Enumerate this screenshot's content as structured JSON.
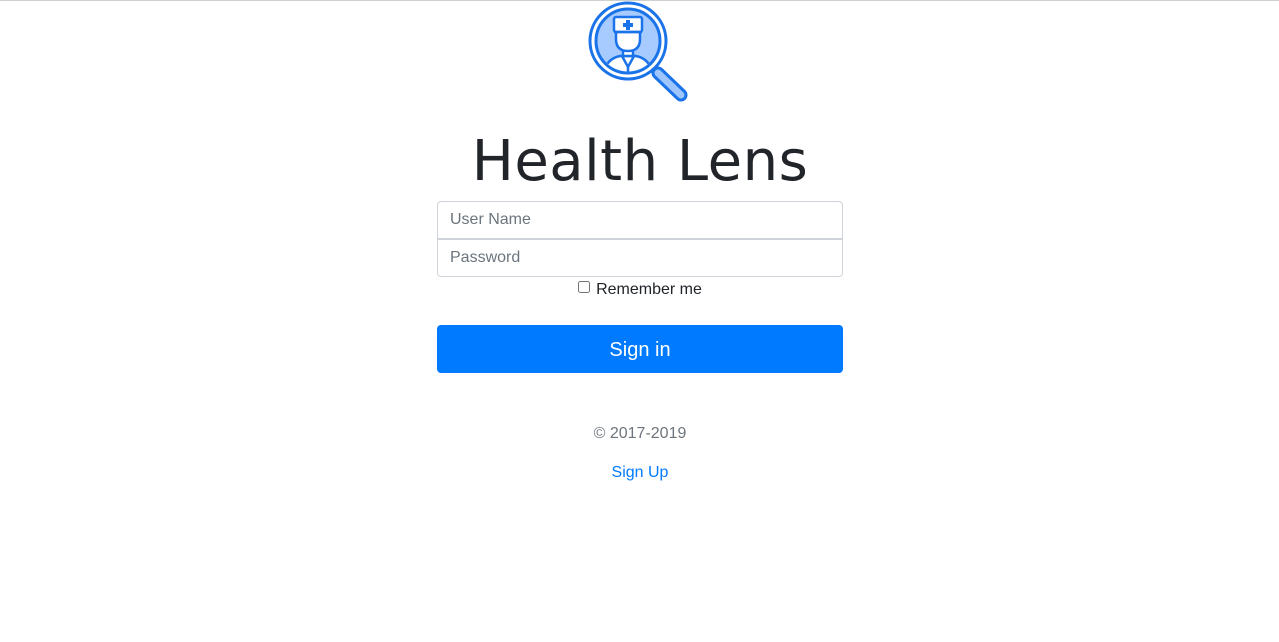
{
  "app": {
    "title": "Health Lens",
    "logo_icon": "doctor-magnifier-icon",
    "brand_color": "#007bff"
  },
  "form": {
    "username_placeholder": "User Name",
    "username_value": "",
    "password_placeholder": "Password",
    "password_value": "",
    "remember_label": "Remember me",
    "remember_checked": false,
    "signin_label": "Sign in"
  },
  "footer": {
    "copyright": "© 2017-2019",
    "signup_label": "Sign Up"
  }
}
